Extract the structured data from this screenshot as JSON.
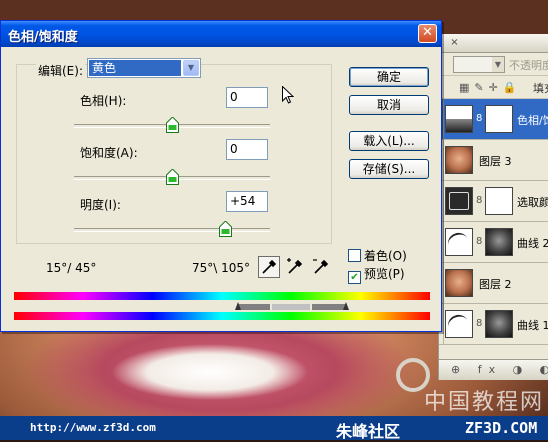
{
  "dialog": {
    "title": "色相/饱和度",
    "close_label": "✕",
    "edit_label": "编辑(E):",
    "edit_value": "黄色",
    "hue": {
      "label": "色相(H):",
      "value": "0",
      "level": 0
    },
    "saturation": {
      "label": "饱和度(A):",
      "value": "0",
      "level": 0
    },
    "lightness": {
      "label": "明度(I):",
      "value": "+54",
      "level": 54
    },
    "range_left": "15°/ 45°",
    "range_right": "75°\\ 105°",
    "buttons": {
      "ok": "确定",
      "cancel": "取消",
      "load": "载入(L)...",
      "save": "存储(S)..."
    },
    "colorize": {
      "label": "着色(O)",
      "checked": false
    },
    "preview": {
      "label": "预览(P)",
      "checked": true
    }
  },
  "layers_panel": {
    "close_tab": "×",
    "opacity_label": "不透明度",
    "fill_label": "填充",
    "layers": [
      {
        "name": "色相/饱和度",
        "selected": true
      },
      {
        "name": "图层 3",
        "selected": false
      },
      {
        "name": "选取颜色",
        "selected": false
      },
      {
        "name": "曲线 2",
        "selected": false
      },
      {
        "name": "图层 2",
        "selected": false
      },
      {
        "name": "曲线 1",
        "selected": false
      }
    ],
    "bottom_icons": "⊕ fx ◑ ◐ ▢ ◻ 🗑"
  },
  "footer": {
    "url": "http://www.zf3d.com",
    "logo": "朱峰社区",
    "site": "ZF3D.COM"
  },
  "watermark": "中国教程网",
  "colors": {
    "title_blue": "#0054e3",
    "selection_blue": "#316ac5",
    "dialog_bg": "#ece9d8",
    "footer_blue": "#0b3e8a"
  }
}
